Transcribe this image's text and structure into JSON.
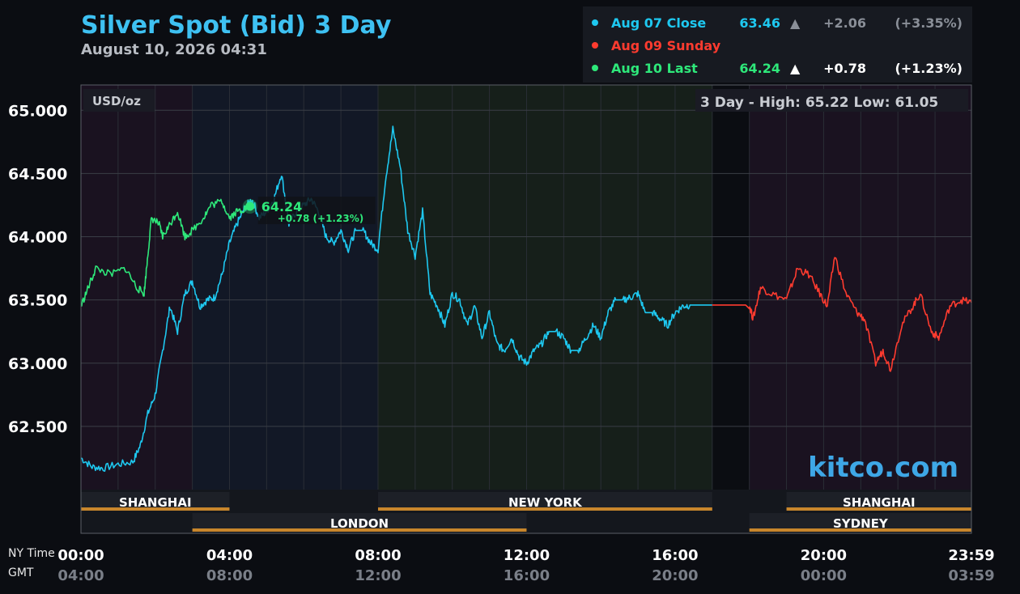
{
  "header": {
    "title": "Silver Spot (Bid) 3 Day",
    "timestamp": "August 10, 2026 04:31"
  },
  "legend": [
    {
      "label": "Aug 07 Close",
      "value": "63.46",
      "arrow": "▲",
      "change": "+2.06",
      "pct": "(+3.35%)",
      "color": "#1ec8f0",
      "muted": true
    },
    {
      "label": "Aug 09 Sunday",
      "value": "",
      "arrow": "",
      "change": "",
      "pct": "",
      "color": "#ff3b2f",
      "muted": false
    },
    {
      "label": "Aug 10 Last",
      "value": "64.24",
      "arrow": "▲",
      "change": "+0.78",
      "pct": "(+1.23%)",
      "color": "#2ee87a",
      "muted": false
    }
  ],
  "plot": {
    "unit": "USD/oz",
    "range_text": "3 Day - High: 65.22  Low: 61.05",
    "brand": "kitco.com",
    "last_label": "64.24",
    "last_change": "+0.78 (+1.23%)"
  },
  "axis": {
    "ny_label": "NY Time",
    "gmt_label": "GMT",
    "ny_ticks": [
      "00:00",
      "04:00",
      "08:00",
      "12:00",
      "16:00",
      "20:00",
      "23:59"
    ],
    "gmt_ticks": [
      "04:00",
      "08:00",
      "12:00",
      "16:00",
      "20:00",
      "00:00",
      "03:59"
    ]
  },
  "sessions": [
    {
      "name": "SHANGHAI",
      "start": 0,
      "end": 4,
      "row": 0
    },
    {
      "name": "NEW YORK",
      "start": 8,
      "end": 17,
      "row": 0
    },
    {
      "name": "SHANGHAI",
      "start": 19,
      "end": 23.98,
      "row": 0
    },
    {
      "name": "LONDON",
      "start": 3,
      "end": 12,
      "row": 1
    },
    {
      "name": "SYDNEY",
      "start": 18,
      "end": 23.98,
      "row": 1
    }
  ],
  "chart_data": {
    "type": "line",
    "title": "Silver Spot (Bid) 3 Day",
    "ylabel": "USD/oz",
    "xlabel": "NY Time",
    "xlim": [
      0,
      23.98
    ],
    "ylim": [
      62.0,
      65.2
    ],
    "yticks": [
      62.5,
      63.0,
      63.5,
      64.0,
      64.5,
      65.0
    ],
    "grid": true,
    "series": [
      {
        "name": "Aug 07 Close",
        "color": "#1ec8f0",
        "x": [
          0,
          0.3,
          0.6,
          1.0,
          1.4,
          1.6,
          1.8,
          2.0,
          2.2,
          2.4,
          2.6,
          2.8,
          3.0,
          3.2,
          3.4,
          3.6,
          3.8,
          4.0,
          4.2,
          4.4,
          4.6,
          4.8,
          5.0,
          5.2,
          5.4,
          5.6,
          5.8,
          6.0,
          6.2,
          6.4,
          6.6,
          6.8,
          7.0,
          7.2,
          7.4,
          7.6,
          7.8,
          8.0,
          8.2,
          8.4,
          8.6,
          8.8,
          9.0,
          9.2,
          9.4,
          9.6,
          9.8,
          10.0,
          10.2,
          10.4,
          10.6,
          10.8,
          11.0,
          11.2,
          11.4,
          11.6,
          11.8,
          12.0,
          12.2,
          12.4,
          12.6,
          12.8,
          13.0,
          13.2,
          13.4,
          13.6,
          13.8,
          14.0,
          14.2,
          14.4,
          14.6,
          14.8,
          15.0,
          15.2,
          15.4,
          15.6,
          15.8,
          16.0,
          16.2,
          16.4,
          16.6,
          16.8,
          17.0
        ],
        "y": [
          62.25,
          62.18,
          62.17,
          62.2,
          62.22,
          62.35,
          62.6,
          62.75,
          63.1,
          63.45,
          63.25,
          63.55,
          63.65,
          63.45,
          63.5,
          63.52,
          63.7,
          63.95,
          64.1,
          64.22,
          64.3,
          64.15,
          64.2,
          64.3,
          64.5,
          64.1,
          64.2,
          64.25,
          64.3,
          64.2,
          64.0,
          63.95,
          64.05,
          63.9,
          64.05,
          64.05,
          63.95,
          63.9,
          64.45,
          64.85,
          64.55,
          64.05,
          63.85,
          64.2,
          63.55,
          63.45,
          63.3,
          63.55,
          63.5,
          63.3,
          63.45,
          63.2,
          63.4,
          63.15,
          63.1,
          63.2,
          63.05,
          63.0,
          63.1,
          63.15,
          63.25,
          63.25,
          63.2,
          63.1,
          63.1,
          63.2,
          63.3,
          63.2,
          63.4,
          63.5,
          63.5,
          63.52,
          63.55,
          63.4,
          63.4,
          63.35,
          63.3,
          63.4,
          63.45,
          63.46,
          63.46,
          63.46,
          63.46
        ]
      },
      {
        "name": "Aug 09 Sunday",
        "color": "#ff3b2f",
        "x": [
          17.0,
          18.0,
          18.1,
          18.3,
          18.6,
          19.0,
          19.3,
          19.6,
          19.9,
          20.1,
          20.3,
          20.6,
          20.9,
          21.1,
          21.4,
          21.6,
          21.8,
          22.1,
          22.4,
          22.6,
          22.9,
          23.1,
          23.4,
          23.7,
          23.98
        ],
        "y": [
          63.46,
          63.46,
          63.35,
          63.6,
          63.55,
          63.5,
          63.75,
          63.7,
          63.55,
          63.45,
          63.85,
          63.55,
          63.4,
          63.35,
          63.0,
          63.1,
          62.95,
          63.3,
          63.45,
          63.55,
          63.25,
          63.2,
          63.45,
          63.5,
          63.48
        ]
      },
      {
        "name": "Aug 10 Last",
        "color": "#2ee87a",
        "x": [
          0,
          0.2,
          0.4,
          0.8,
          1.2,
          1.5,
          1.7,
          1.8,
          1.9,
          2.1,
          2.2,
          2.4,
          2.6,
          2.8,
          3.0,
          3.3,
          3.5,
          3.8,
          4.0,
          4.2,
          4.4,
          4.55
        ],
        "y": [
          63.45,
          63.6,
          63.75,
          63.7,
          63.75,
          63.6,
          63.55,
          63.85,
          64.15,
          64.1,
          64.0,
          64.1,
          64.2,
          64.0,
          64.05,
          64.15,
          64.25,
          64.28,
          64.15,
          64.2,
          64.22,
          64.24
        ]
      }
    ]
  }
}
